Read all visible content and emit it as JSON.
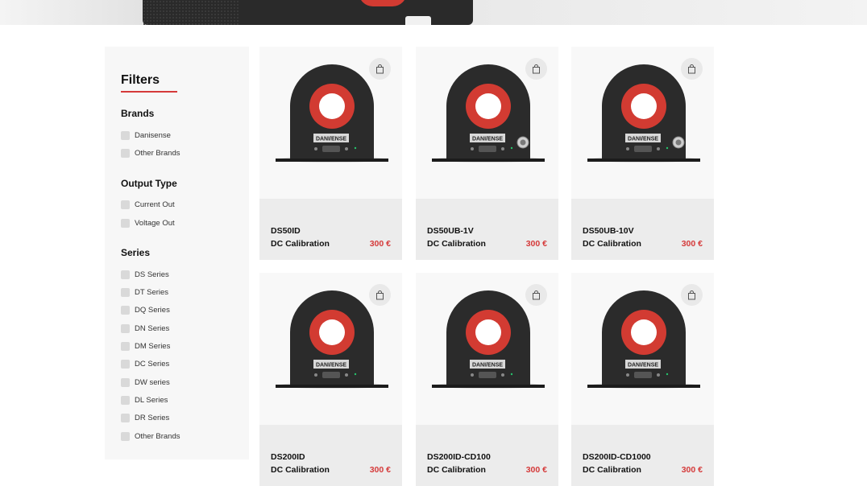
{
  "filters": {
    "title": "Filters",
    "groups": [
      {
        "title": "Brands",
        "options": [
          "Danisense",
          "Other Brands"
        ]
      },
      {
        "title": "Output Type",
        "options": [
          "Current Out",
          "Voltage Out"
        ]
      },
      {
        "title": "Series",
        "options": [
          "DS Series",
          "DT Series",
          "DQ Series",
          "DN Series",
          "DM Series",
          "DC Series",
          "DW series",
          "DL Series",
          "DR Series",
          "Other Brands"
        ]
      }
    ]
  },
  "products": [
    {
      "name": "DS50ID",
      "subtitle": "DC Calibration",
      "price": "300 €",
      "label": "DANI/ENSE",
      "connector": false
    },
    {
      "name": "DS50UB-1V",
      "subtitle": "DC Calibration",
      "price": "300 €",
      "label": "DANI/ENSE",
      "connector": true
    },
    {
      "name": "DS50UB-10V",
      "subtitle": "DC Calibration",
      "price": "300 €",
      "label": "DANI/ENSE",
      "connector": true
    },
    {
      "name": "DS200ID",
      "subtitle": "DC Calibration",
      "price": "300 €",
      "label": "DANI/ENSE",
      "connector": false
    },
    {
      "name": "DS200ID-CD100",
      "subtitle": "DC Calibration",
      "price": "300 €",
      "label": "DANI/ENSE",
      "connector": false
    },
    {
      "name": "DS200ID-CD1000",
      "subtitle": "DC Calibration",
      "price": "300 €",
      "label": "DANI/ENSE",
      "connector": false
    }
  ],
  "icons": {
    "cart": "shopping-bag-icon"
  },
  "colors": {
    "accent": "#d53a3a",
    "sensor_ring": "#d23b32",
    "sensor_body": "#2b2b2b"
  }
}
